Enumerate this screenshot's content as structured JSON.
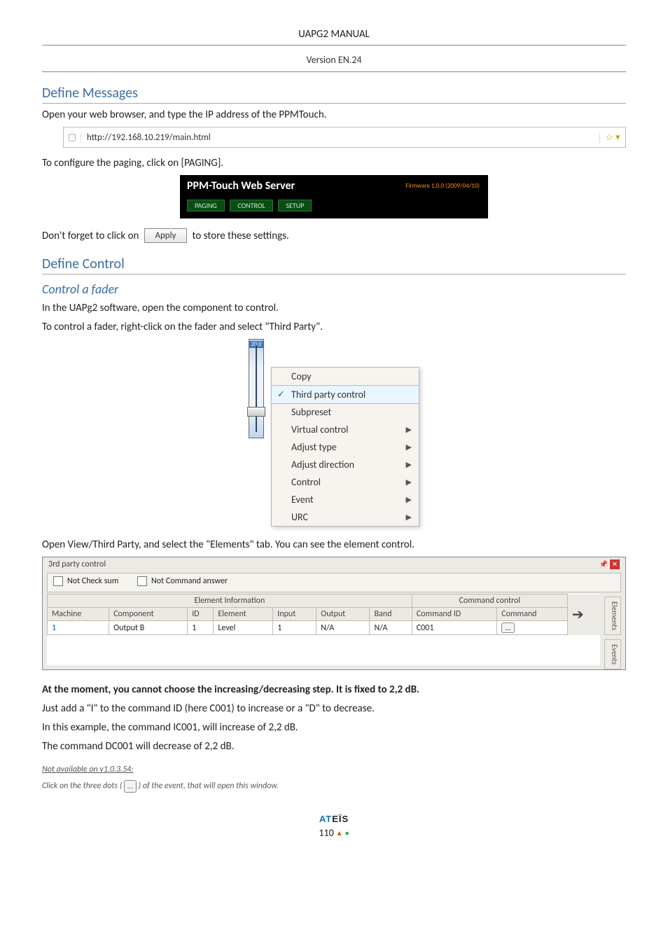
{
  "doc": {
    "title": "UAPG2  MANUAL",
    "version": "Version EN.24"
  },
  "sections": {
    "define_messages": "Define Messages",
    "define_control": "Define Control",
    "control_fader": "Control a fader"
  },
  "text": {
    "open_browser": "Open your web browser, and type the IP address of the PPMTouch.",
    "configure_paging": "To configure the paging, click on [PAGING].",
    "dont_forget_pre": "Don't forget to click on",
    "dont_forget_post": "to store these settings.",
    "apply_label": "Apply",
    "open_component": "In the UAPg2 software, open the component to control.",
    "control_right_click": "To control a fader, right-click on the fader and select \"Third Party\".",
    "open_elements": "Open View/Third Party, and select the \"Elements\" tab. You can see the element control.",
    "no_step": "At the moment, you cannot choose the increasing/decreasing step. It is fixed to 2,2 dB.",
    "add_i": "Just add a \"I\" to the command ID (here C001) to increase or a \"D\" to decrease.",
    "example": "In this example, the command IC001, will increase of 2,2 dB.",
    "dc001": "The command DC001 will decrease of 2,2 dB.",
    "not_avail": "Not available on v1.0.3.54:",
    "click_dots_pre": "Click on the three dots (",
    "click_dots_post": ") of the event, that will open this window."
  },
  "addr": {
    "url": "http://192.168.10.219/main.html"
  },
  "ppm": {
    "title": "PPM-Touch Web Server",
    "fw": "Firmware 1.0.0 (2009/04/10)",
    "buttons": [
      "PAGING",
      "CONTROL",
      "SETUP"
    ]
  },
  "ctx": {
    "fader_value": "20.0",
    "items": [
      {
        "label": "Copy",
        "arrow": false,
        "checked": false,
        "selected": false,
        "sep_after": true
      },
      {
        "label": "Third party control",
        "arrow": false,
        "checked": true,
        "selected": true,
        "sep_after": false
      },
      {
        "label": "Subpreset",
        "arrow": false,
        "checked": false,
        "selected": false,
        "sep_after": false
      },
      {
        "label": "Virtual control",
        "arrow": true,
        "checked": false,
        "selected": false,
        "sep_after": false
      },
      {
        "label": "Adjust type",
        "arrow": true,
        "checked": false,
        "selected": false,
        "sep_after": false
      },
      {
        "label": "Adjust direction",
        "arrow": true,
        "checked": false,
        "selected": false,
        "sep_after": false
      },
      {
        "label": "Control",
        "arrow": true,
        "checked": false,
        "selected": false,
        "sep_after": false
      },
      {
        "label": "Event",
        "arrow": true,
        "checked": false,
        "selected": false,
        "sep_after": false
      },
      {
        "label": "URC",
        "arrow": true,
        "checked": false,
        "selected": false,
        "sep_after": false
      }
    ]
  },
  "thirdparty": {
    "title": "3rd party control",
    "chk_sum": "Not Check sum",
    "chk_cmd": "Not Command answer",
    "group_left": "Element Information",
    "group_right": "Command control",
    "cols": [
      "Machine",
      "Component",
      "ID",
      "Element",
      "Input",
      "Output",
      "Band",
      "Command ID",
      "Command"
    ],
    "row": {
      "Machine": "1",
      "Component": "Output B",
      "ID": "1",
      "Element": "Level",
      "Input": "1",
      "Output": "N/A",
      "Band": "N/A",
      "CommandID": "C001",
      "Command": "..."
    },
    "side_tabs": [
      "Elements",
      "Events"
    ]
  },
  "footer": {
    "brand": "ATEÏS",
    "page": "110"
  }
}
